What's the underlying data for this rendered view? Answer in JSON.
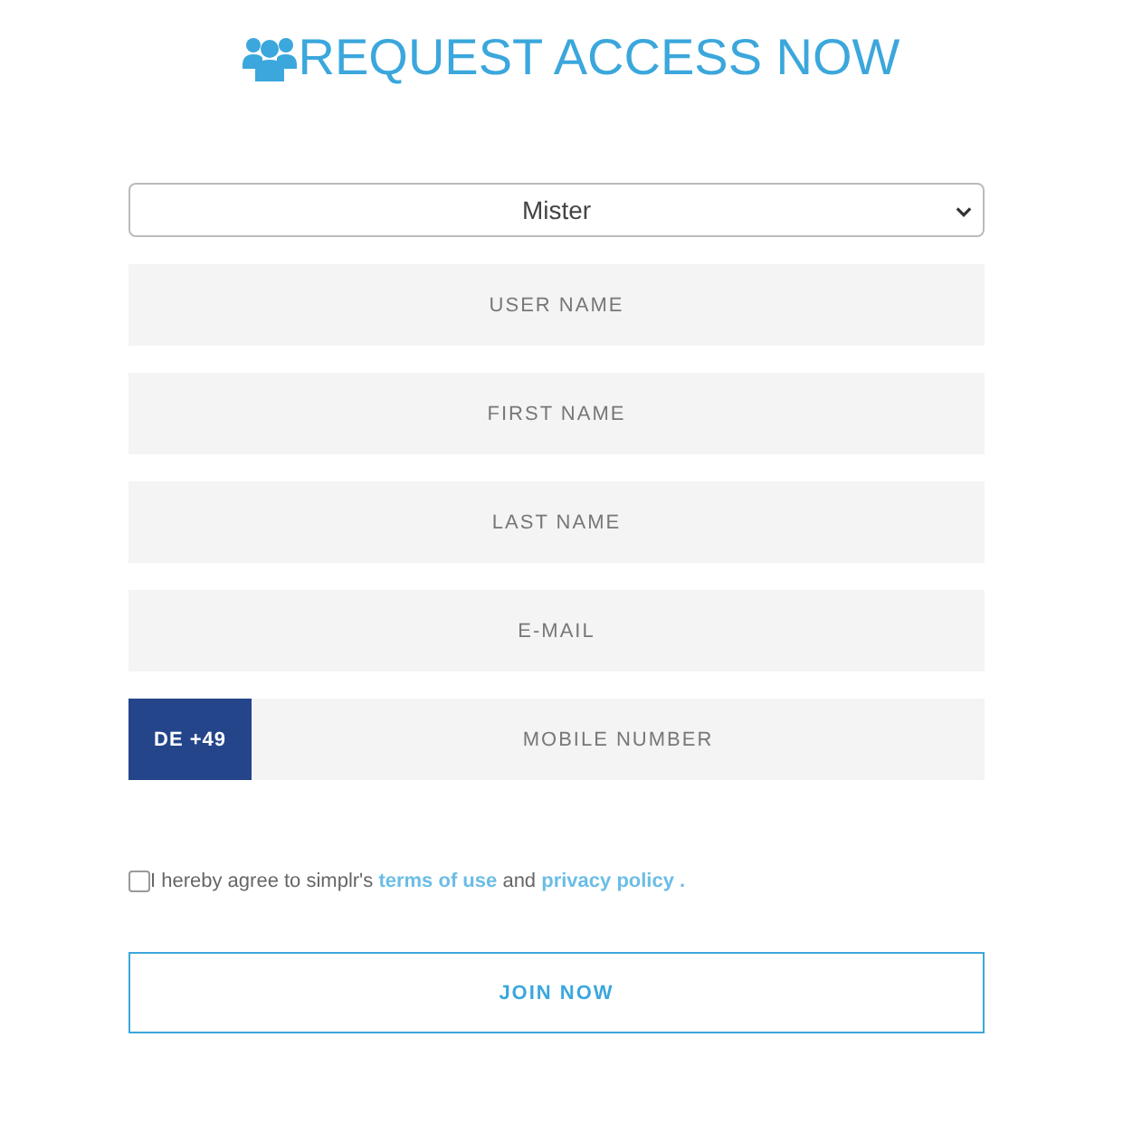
{
  "title": "REQUEST ACCESS NOW",
  "salutation": {
    "value": "Mister"
  },
  "fields": [
    {
      "placeholder": "USER NAME"
    },
    {
      "placeholder": "FIRST NAME"
    },
    {
      "placeholder": "LAST NAME"
    },
    {
      "placeholder": "E-MAIL"
    }
  ],
  "phone": {
    "country_code": "DE +49",
    "placeholder": "MOBILE NUMBER"
  },
  "agreement": {
    "checked": false,
    "text_before": "I hereby agree to simplr's",
    "link_terms": "terms of use",
    "text_middle": "and",
    "link_privacy": "privacy policy ."
  },
  "submit": {
    "label": "JOIN NOW"
  }
}
